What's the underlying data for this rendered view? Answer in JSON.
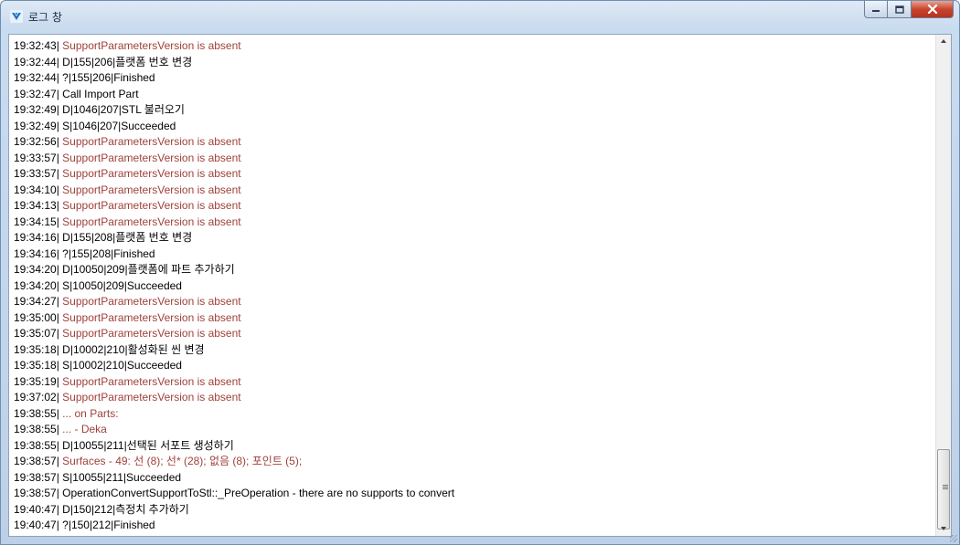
{
  "window": {
    "title": "로그 창"
  },
  "colors": {
    "normal_text": "#000000",
    "warning_text": "#a0403a",
    "close_button": "#c9452f"
  },
  "icons": {
    "app": "app-logo-icon",
    "minimize": "minimize-icon",
    "maximize": "maximize-icon",
    "close": "close-icon"
  },
  "log": [
    {
      "time": "19:32:43|",
      "text": "SupportParametersVersion is absent",
      "warn": true
    },
    {
      "time": "19:32:44|",
      "text": "D|155|206|플랫폼 번호 변경",
      "warn": false
    },
    {
      "time": "19:32:44|",
      "text": "?|155|206|Finished",
      "warn": false
    },
    {
      "time": "19:32:47|",
      "text": "Call Import Part",
      "warn": false
    },
    {
      "time": "19:32:49|",
      "text": "D|1046|207|STL 불러오기",
      "warn": false
    },
    {
      "time": "19:32:49|",
      "text": "S|1046|207|Succeeded",
      "warn": false
    },
    {
      "time": "19:32:56|",
      "text": "SupportParametersVersion is absent",
      "warn": true
    },
    {
      "time": "19:33:57|",
      "text": "SupportParametersVersion is absent",
      "warn": true
    },
    {
      "time": "19:33:57|",
      "text": "SupportParametersVersion is absent",
      "warn": true
    },
    {
      "time": "19:34:10|",
      "text": "SupportParametersVersion is absent",
      "warn": true
    },
    {
      "time": "19:34:13|",
      "text": "SupportParametersVersion is absent",
      "warn": true
    },
    {
      "time": "19:34:15|",
      "text": "SupportParametersVersion is absent",
      "warn": true
    },
    {
      "time": "19:34:16|",
      "text": "D|155|208|플랫폼 번호 변경",
      "warn": false
    },
    {
      "time": "19:34:16|",
      "text": "?|155|208|Finished",
      "warn": false
    },
    {
      "time": "19:34:20|",
      "text": "D|10050|209|플랫폼에 파트 추가하기",
      "warn": false
    },
    {
      "time": "19:34:20|",
      "text": "S|10050|209|Succeeded",
      "warn": false
    },
    {
      "time": "19:34:27|",
      "text": "SupportParametersVersion is absent",
      "warn": true
    },
    {
      "time": "19:35:00|",
      "text": "SupportParametersVersion is absent",
      "warn": true
    },
    {
      "time": "19:35:07|",
      "text": "SupportParametersVersion is absent",
      "warn": true
    },
    {
      "time": "19:35:18|",
      "text": "D|10002|210|활성화된 씬 변경",
      "warn": false
    },
    {
      "time": "19:35:18|",
      "text": "S|10002|210|Succeeded",
      "warn": false
    },
    {
      "time": "19:35:19|",
      "text": "SupportParametersVersion is absent",
      "warn": true
    },
    {
      "time": "19:37:02|",
      "text": "SupportParametersVersion is absent",
      "warn": true
    },
    {
      "time": "19:38:55|",
      "text": "... on Parts:",
      "warn": true
    },
    {
      "time": "19:38:55|",
      "text": "... - Deka",
      "warn": true
    },
    {
      "time": "19:38:55|",
      "text": "D|10055|211|선택된 서포트 생성하기",
      "warn": false
    },
    {
      "time": "19:38:57|",
      "text": "Surfaces - 49: 선 (8); 선* (28); 없음 (8); 포인트 (5);",
      "warn": true
    },
    {
      "time": "19:38:57|",
      "text": "S|10055|211|Succeeded",
      "warn": false
    },
    {
      "time": "19:38:57|",
      "text": "OperationConvertSupportToStl::_PreOperation - there are no supports to convert",
      "warn": false
    },
    {
      "time": "19:40:47|",
      "text": "D|150|212|측정치 추가하기",
      "warn": false
    },
    {
      "time": "19:40:47|",
      "text": "?|150|212|Finished",
      "warn": false
    }
  ]
}
